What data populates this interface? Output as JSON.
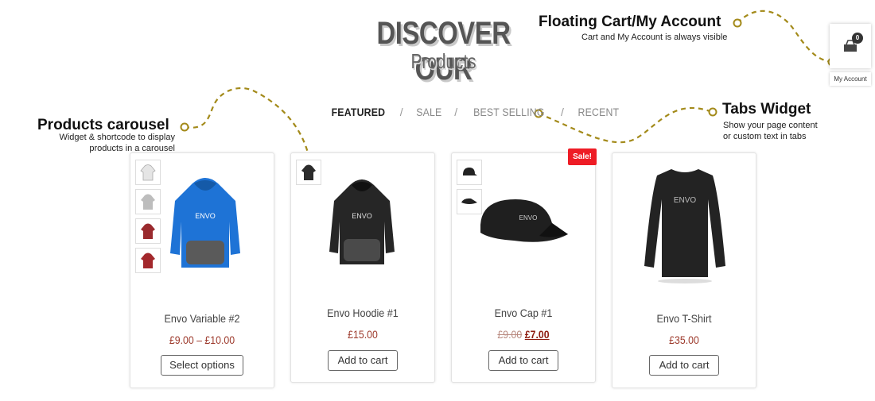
{
  "heading": {
    "main": "DISCOVER OUR",
    "sub": "Products"
  },
  "annotations": {
    "cart": {
      "title": "Floating Cart/My Account",
      "desc": "Cart and My Account is always visible"
    },
    "carousel": {
      "title": "Products carousel",
      "desc_line1": "Widget & shortcode to display",
      "desc_line2": "products in a carousel"
    },
    "tabs": {
      "title": "Tabs Widget",
      "desc_line1": "Show your page content",
      "desc_line2": "or custom text in tabs"
    }
  },
  "tabs": [
    {
      "label": "FEATURED",
      "active": true
    },
    {
      "label": "SALE",
      "active": false
    },
    {
      "label": "BEST SELLING",
      "active": false
    },
    {
      "label": "RECENT",
      "active": false
    }
  ],
  "tab_separator": "/",
  "cart": {
    "count": "0",
    "account_label": "My Account",
    "icon": "cart-icon"
  },
  "products": [
    {
      "title": "Envo Variable #2",
      "price": "£9.00 – £10.00",
      "button": "Select options",
      "image": "blue-hoodie"
    },
    {
      "title": "Envo Hoodie #1",
      "price": "£15.00",
      "button": "Add to cart",
      "image": "black-hoodie"
    },
    {
      "title": "Envo Cap #1",
      "price_old": "£9.00",
      "price_new": "£7.00",
      "badge": "Sale!",
      "button": "Add to cart",
      "image": "black-cap"
    },
    {
      "title": "Envo T-Shirt",
      "price": "£35.00",
      "button": "Add to cart",
      "image": "black-tshirt"
    }
  ],
  "carousel_nav": {
    "prev": "‹",
    "next": "›"
  },
  "colors": {
    "accent_dashed": "#a38a1a",
    "price": "#9d3a2c",
    "sale_badge": "#ee1c25"
  }
}
